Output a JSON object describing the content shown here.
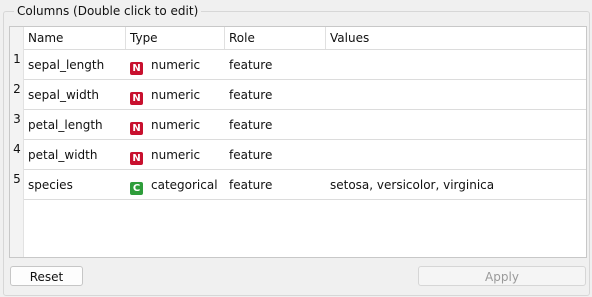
{
  "group": {
    "title": "Columns (Double click to edit)"
  },
  "table": {
    "headers": {
      "name": "Name",
      "type": "Type",
      "role": "Role",
      "values": "Values"
    },
    "rows": [
      {
        "num": "1",
        "name": "sepal_length",
        "badge": "N",
        "badge_color": "#c8102e",
        "type": "numeric",
        "role": "feature",
        "values": ""
      },
      {
        "num": "2",
        "name": "sepal_width",
        "badge": "N",
        "badge_color": "#c8102e",
        "type": "numeric",
        "role": "feature",
        "values": ""
      },
      {
        "num": "3",
        "name": "petal_length",
        "badge": "N",
        "badge_color": "#c8102e",
        "type": "numeric",
        "role": "feature",
        "values": ""
      },
      {
        "num": "4",
        "name": "petal_width",
        "badge": "N",
        "badge_color": "#c8102e",
        "type": "numeric",
        "role": "feature",
        "values": ""
      },
      {
        "num": "5",
        "name": "species",
        "badge": "C",
        "badge_color": "#2e9d3a",
        "type": "categorical",
        "role": "feature",
        "values": "setosa, versicolor, virginica"
      }
    ]
  },
  "buttons": {
    "reset": "Reset",
    "apply": "Apply"
  }
}
